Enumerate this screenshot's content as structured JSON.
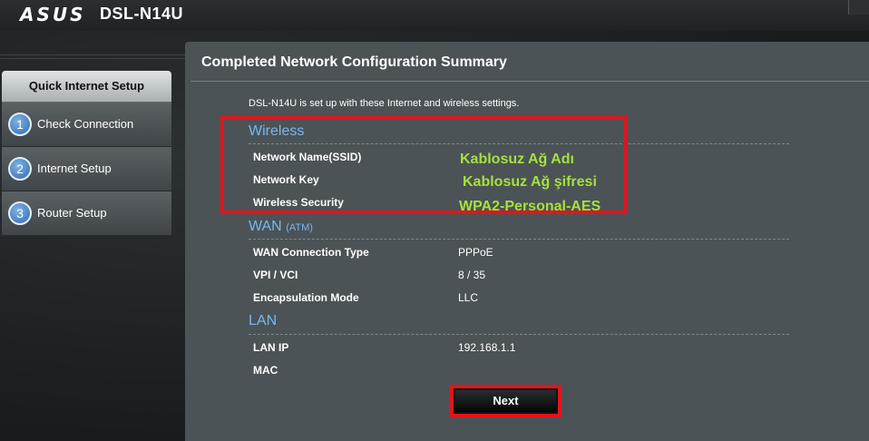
{
  "header": {
    "brand": "ASUS",
    "model": "DSL-N14U"
  },
  "sidebar": {
    "title": "Quick Internet Setup",
    "items": [
      {
        "num": "1",
        "label": "Check Connection"
      },
      {
        "num": "2",
        "label": "Internet Setup"
      },
      {
        "num": "3",
        "label": "Router Setup"
      }
    ]
  },
  "main": {
    "title": "Completed Network Configuration Summary",
    "intro": "DSL-N14U is set up with these Internet and wireless settings.",
    "wireless": {
      "title": "Wireless",
      "rows": [
        {
          "label": "Network Name(SSID)",
          "value": "Kablosuz Ağ Adı"
        },
        {
          "label": "Network Key",
          "value": "Kablosuz Ağ şifresi"
        },
        {
          "label": "Wireless Security",
          "value": "WPA2-Personal-AES"
        }
      ]
    },
    "wan": {
      "title": "WAN",
      "subtitle": "(ATM)",
      "rows": [
        {
          "label": "WAN Connection Type",
          "value": "PPPoE"
        },
        {
          "label": "VPI / VCI",
          "value": "8 / 35"
        },
        {
          "label": "Encapsulation Mode",
          "value": "LLC"
        }
      ]
    },
    "lan": {
      "title": "LAN",
      "rows": [
        {
          "label": "LAN IP",
          "value": "192.168.1.1"
        },
        {
          "label": "MAC",
          "value": ""
        }
      ]
    },
    "next_label": "Next"
  },
  "colors": {
    "accent_blue": "#78b8ec",
    "highlight_green": "#a6e13a",
    "highlight_red": "#e3141c",
    "panel_bg": "#4b5357"
  }
}
